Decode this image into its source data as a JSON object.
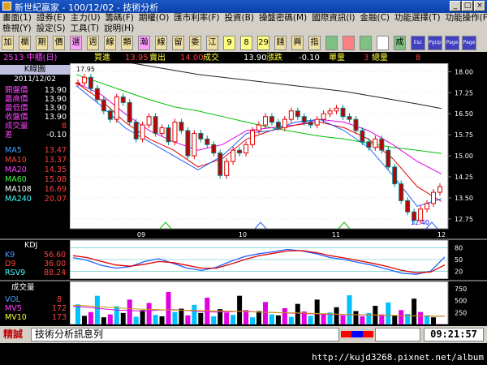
{
  "window": {
    "title": "新世紀贏家 - 100/12/02 - 技術分析",
    "buttons": [
      "_",
      "□",
      "×"
    ]
  },
  "menu": {
    "row1": [
      "畫面(1)",
      "證券(E)",
      "主力(U)",
      "籌碼(F)",
      "期權(O)",
      "匯市利率(F)",
      "投資(B)",
      "操盤密碼(M)",
      "國際資訊(I)",
      "金融(C)",
      "功能選擇(T)",
      "功能操作(F)"
    ],
    "row2": [
      "檢視(Y)",
      "設定(S)",
      "工具(T)",
      "說明(H)"
    ]
  },
  "toolbar": {
    "buttons": [
      "加",
      "欄",
      "期",
      "價",
      "選",
      "週",
      "線",
      "類",
      "瀚",
      "線",
      "留",
      "委",
      "江",
      "9",
      "8",
      "29",
      "錢",
      "興",
      "指",
      "",
      "",
      "",
      "",
      "成",
      "Esc",
      "PgUp",
      "Page Up",
      "Page Down"
    ]
  },
  "info": {
    "stock": "2513 中櫃(日)",
    "buy_label": "買進",
    "buy_value": "13.95",
    "sell_label": "賣出",
    "sell_value": "14.00",
    "trade_label": "成交",
    "trade_value": "13.90",
    "change_label": "漲跌",
    "change_value": "-0.10",
    "volume_label": "單量",
    "volume_value": "3",
    "total_label": "總量",
    "total_value": "8"
  },
  "side": {
    "header": "K線圖",
    "date": "2011/12/02",
    "quotes": [
      {
        "label": "開盤價",
        "value": "13.90"
      },
      {
        "label": "最高價",
        "value": "13.90"
      },
      {
        "label": "最低價",
        "value": "13.90"
      },
      {
        "label": "收盤價",
        "value": "13.90"
      },
      {
        "label": "成交量",
        "value": "8"
      },
      {
        "label": "差",
        "value": "-0.10"
      }
    ],
    "ma": [
      {
        "label": "MA5",
        "value": "13.47",
        "color": "#40a0ff"
      },
      {
        "label": "MA10",
        "value": "13.37",
        "color": "#ff4040"
      },
      {
        "label": "MA20",
        "value": "14.35",
        "color": "#ff40ff"
      },
      {
        "label": "MA60",
        "value": "15.08",
        "color": "#40ff40"
      },
      {
        "label": "MA108",
        "value": "16.69",
        "color": "#ffffff"
      },
      {
        "label": "MA240",
        "value": "20.07",
        "color": "#40ffff"
      }
    ]
  },
  "kdj": {
    "title": "KDJ",
    "k_label": "K9",
    "k_value": "56.60",
    "d_label": "D9",
    "d_value": "36.00",
    "rsv_label": "RSV9",
    "rsv_value": "88.24"
  },
  "vol": {
    "title": "成交量",
    "vol_label": "VOL",
    "vol_value": "8",
    "mv5_label": "MV5",
    "mv5_value": "172",
    "mv10_label": "MV10",
    "mv10_value": "173"
  },
  "status": {
    "mode": "精誠",
    "message": "技術分析訊息列",
    "time": "09:21:57"
  },
  "watermark": "http://kujd3268.pixnet.net/album",
  "chart_data": [
    {
      "type": "candlestick",
      "yticks": [
        "18.00",
        "17.25",
        "16.50",
        "15.75",
        "15.00",
        "14.25",
        "13.50",
        "12.75"
      ],
      "ylim": [
        12.4,
        18.3
      ],
      "xticks": [
        "09",
        "10",
        "11",
        "12"
      ],
      "annotations": [
        "17.95",
        "12.40"
      ],
      "series": [
        {
          "name": "MA60",
          "values": [
            17.9,
            17.6,
            17.3,
            17.0,
            16.75,
            16.6,
            16.4,
            16.2,
            16.0,
            15.85,
            15.7,
            15.6,
            15.45,
            15.3,
            15.2,
            15.08
          ]
        },
        {
          "name": "MA108",
          "values": [
            18.6,
            18.5,
            18.35,
            18.2,
            18.05,
            17.9,
            17.8,
            17.7,
            17.6,
            17.5,
            17.4,
            17.3,
            17.15,
            17.0,
            16.85,
            16.69
          ]
        },
        {
          "name": "MA20",
          "values": [
            17.6,
            17.2,
            16.5,
            15.9,
            15.5,
            15.2,
            15.4,
            15.9,
            16.0,
            16.1,
            16.3,
            16.2,
            15.9,
            15.4,
            14.8,
            14.35
          ]
        },
        {
          "name": "MA10",
          "values": [
            17.6,
            17.0,
            16.2,
            15.6,
            15.2,
            14.6,
            14.9,
            15.6,
            15.9,
            16.1,
            16.2,
            16.0,
            15.6,
            14.9,
            13.9,
            13.37
          ]
        },
        {
          "name": "MA5",
          "values": [
            17.5,
            16.8,
            16.0,
            15.5,
            15.0,
            14.5,
            15.0,
            15.8,
            15.9,
            16.2,
            16.3,
            15.9,
            15.3,
            14.3,
            13.2,
            13.47
          ]
        }
      ],
      "candles": [
        17.6,
        17.8,
        17.4,
        17.0,
        16.6,
        16.3,
        17.1,
        16.9,
        16.2,
        15.6,
        16.1,
        16.4,
        15.8,
        16.0,
        15.5,
        16.2,
        15.9,
        15.0,
        15.8,
        15.6,
        15.4,
        15.1,
        14.3,
        14.8,
        15.2,
        15.1,
        15.4,
        15.9,
        16.1,
        16.4,
        16.2,
        16.0,
        16.3,
        16.6,
        16.4,
        16.2,
        16.1,
        16.3,
        16.5,
        16.6,
        16.7,
        16.4,
        16.3,
        15.9,
        15.5,
        15.3,
        15.6,
        15.2,
        14.6,
        14.0,
        13.4,
        13.0,
        12.7,
        13.1,
        13.3,
        13.7,
        13.9
      ]
    },
    {
      "type": "line",
      "yticks": [
        "80",
        "50",
        "20"
      ],
      "ylim": [
        0,
        100
      ],
      "series": [
        {
          "name": "K9",
          "values": [
            55,
            48,
            35,
            28,
            32,
            45,
            52,
            40,
            28,
            22,
            30,
            45,
            58,
            65,
            70,
            76,
            72,
            65,
            55,
            50,
            42,
            35,
            25,
            15,
            12,
            20,
            56.6
          ]
        },
        {
          "name": "D9",
          "values": [
            60,
            55,
            45,
            36,
            33,
            38,
            45,
            42,
            35,
            28,
            28,
            38,
            50,
            60,
            66,
            72,
            73,
            68,
            60,
            54,
            47,
            40,
            32,
            22,
            16,
            18,
            36
          ]
        }
      ]
    },
    {
      "type": "bar",
      "yticks": [
        "750",
        "500",
        "250"
      ],
      "ylim": [
        0,
        900
      ],
      "series": [
        {
          "name": "VOL",
          "values": [
            420,
            180,
            260,
            600,
            150,
            210,
            380,
            240,
            520,
            160,
            300,
            450,
            200,
            170,
            680,
            260,
            330,
            190,
            410,
            240,
            560,
            170,
            320,
            250,
            200,
            600,
            300,
            150,
            280,
            470,
            210,
            190,
            340,
            160,
            430,
            270,
            180,
            520,
            220,
            250,
            360,
            190,
            610,
            280,
            170,
            240,
            390,
            210,
            460,
            180,
            300,
            220,
            540,
            260,
            190,
            150,
            8
          ]
        },
        {
          "name": "MV5",
          "values": [
            380,
            360,
            330,
            300,
            290,
            280,
            300,
            310,
            290,
            270,
            260,
            270,
            280,
            260,
            250,
            240,
            230,
            220,
            210,
            205,
            200,
            195,
            190,
            185,
            180,
            175,
            172
          ]
        },
        {
          "name": "MV10",
          "values": [
            400,
            390,
            370,
            350,
            330,
            320,
            310,
            300,
            295,
            290,
            285,
            280,
            270,
            260,
            250,
            245,
            240,
            230,
            220,
            210,
            205,
            198,
            190,
            185,
            180,
            176,
            173
          ]
        }
      ]
    }
  ]
}
